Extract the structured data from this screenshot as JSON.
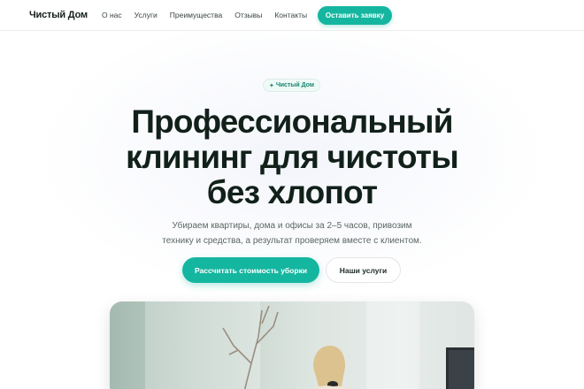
{
  "header": {
    "logo": "Чистый Дом",
    "nav": [
      "О нас",
      "Услуги",
      "Преимущества",
      "Отзывы",
      "Контакты"
    ],
    "cta": "Оставить заявку"
  },
  "hero": {
    "badge_icon": "sparkle-icon",
    "badge": "Чистый Дом",
    "title": [
      "Профессиональный",
      "клининг для чистоты",
      "без хлопот"
    ],
    "subtitle": [
      "Убираем квартиры, дома и офисы за 2–5 часов, привозим",
      "технику и средства, а результат проверяем вместе с клиентом."
    ],
    "primary_button": "Рассчитать стоимость уборки",
    "secondary_button": "Наши услуги"
  },
  "colors": {
    "accent": "#15b6a0",
    "text_dark": "#12201a",
    "text_muted": "#5b6661"
  }
}
